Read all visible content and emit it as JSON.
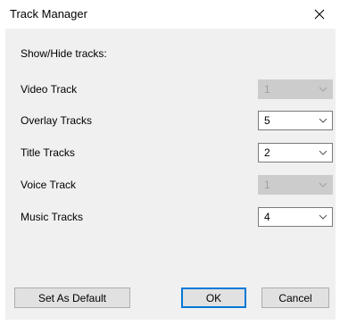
{
  "window": {
    "title": "Track Manager"
  },
  "section_label": "Show/Hide tracks:",
  "tracks": [
    {
      "label": "Video Track",
      "value": "1",
      "enabled": false
    },
    {
      "label": "Overlay Tracks",
      "value": "5",
      "enabled": true
    },
    {
      "label": "Title Tracks",
      "value": "2",
      "enabled": true
    },
    {
      "label": "Voice Track",
      "value": "1",
      "enabled": false
    },
    {
      "label": "Music Tracks",
      "value": "4",
      "enabled": true
    }
  ],
  "buttons": {
    "set_default": "Set As Default",
    "ok": "OK",
    "cancel": "Cancel"
  },
  "icons": {
    "close": "close-icon",
    "dropdown": "chevron-down-icon"
  },
  "colors": {
    "dialog_bg": "#f0f0f0",
    "titlebar_bg": "#ffffff",
    "default_button_border": "#0078d7",
    "disabled_select_bg": "#cccccc"
  }
}
